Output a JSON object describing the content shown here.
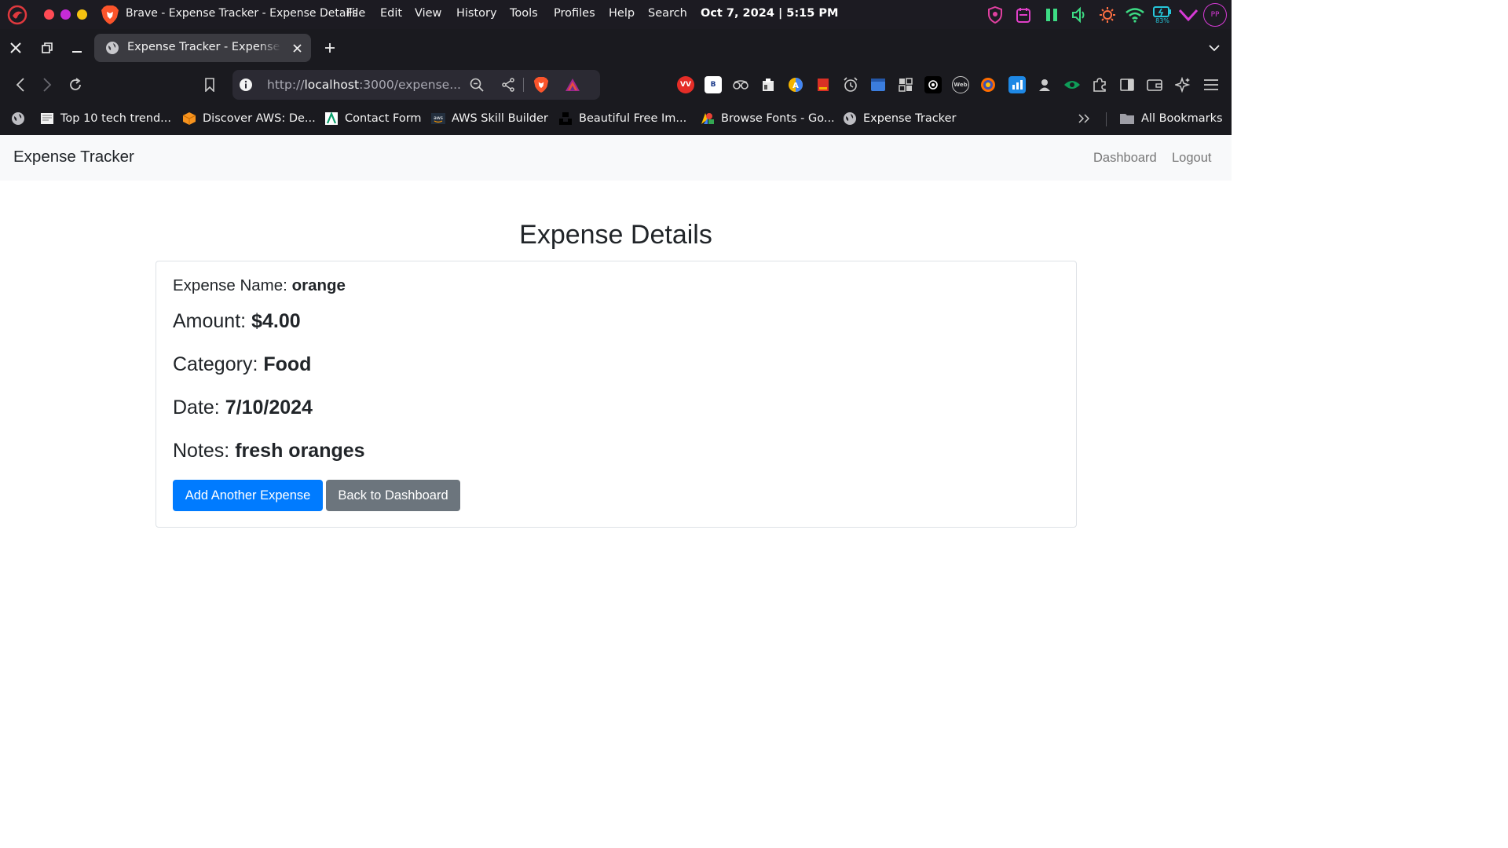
{
  "os": {
    "window_title": "Brave - Expense Tracker - Expense Details",
    "menu": [
      "File",
      "Edit",
      "View",
      "History",
      "Tools",
      "Profiles",
      "Help",
      "Search"
    ],
    "clock": "Oct 7, 2024 | 5:15 PM",
    "battery_percent": "83%",
    "profile_initials": "PP"
  },
  "browser": {
    "tab_title": "Expense Tracker - Expense Details",
    "url_prefix": "http://",
    "url_host": "localhost",
    "url_rest": ":3000/expense..."
  },
  "bookmarks": [
    {
      "label": "Top 10 tech trend...",
      "icon": "newspaper-icon"
    },
    {
      "label": "Discover AWS: De...",
      "icon": "aws-cube-icon"
    },
    {
      "label": "Contact Form",
      "icon": "form-icon"
    },
    {
      "label": "AWS Skill Builder",
      "icon": "aws-icon"
    },
    {
      "label": "Beautiful Free Im...",
      "icon": "unsplash-icon"
    },
    {
      "label": "Browse Fonts - Go...",
      "icon": "google-fonts-icon"
    },
    {
      "label": "Expense Tracker",
      "icon": "globe-icon"
    }
  ],
  "all_bookmarks_label": "All Bookmarks",
  "page": {
    "brand": "Expense Tracker",
    "nav": {
      "dashboard": "Dashboard",
      "logout": "Logout"
    },
    "heading": "Expense Details",
    "expense": {
      "name_label": "Expense Name:",
      "name_value": "orange",
      "amount_label": "Amount:",
      "amount_value": "$4.00",
      "category_label": "Category:",
      "category_value": "Food",
      "date_label": "Date:",
      "date_value": "7/10/2024",
      "notes_label": "Notes:",
      "notes_value": "fresh oranges"
    },
    "buttons": {
      "add": "Add Another Expense",
      "back": "Back to Dashboard"
    }
  },
  "colors": {
    "primary": "#007bff",
    "secondary": "#6c757d",
    "navbar_bg": "#f8f9fa",
    "browser_chrome": "#1a1a1f"
  }
}
